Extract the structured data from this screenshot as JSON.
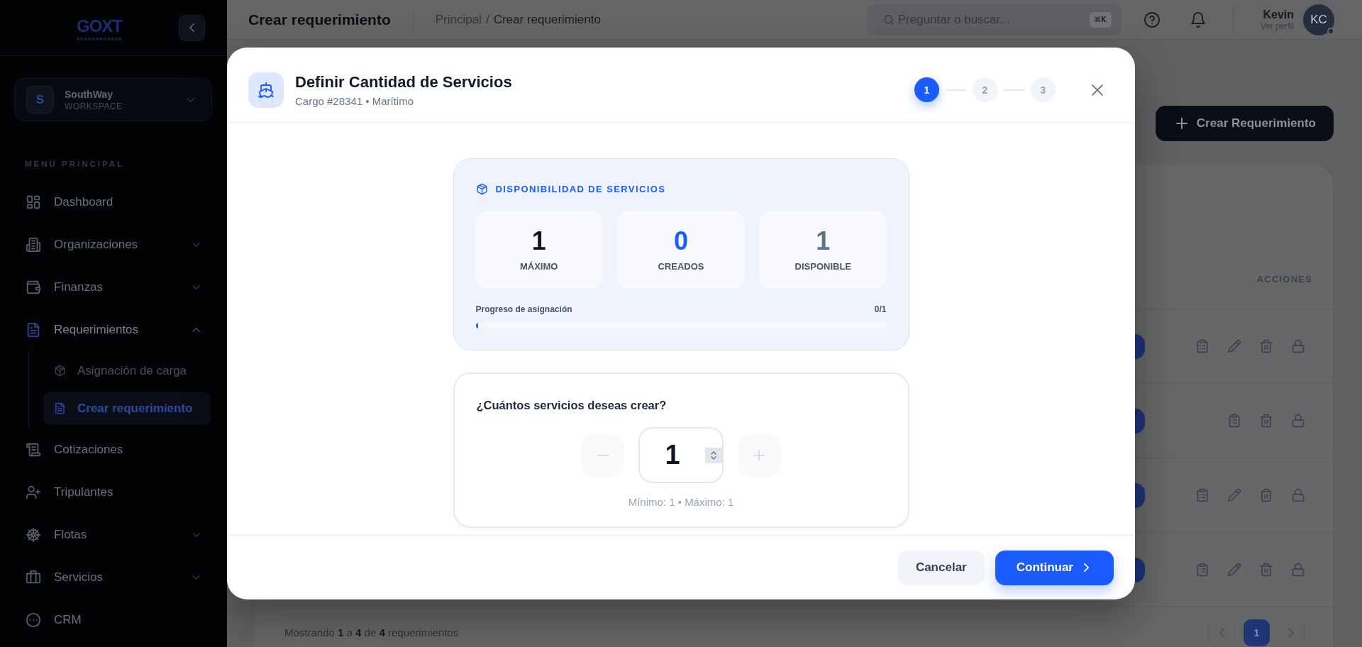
{
  "sidebar": {
    "logo": "GOXT",
    "workspace": {
      "initial": "S",
      "name": "SouthWay",
      "label": "WORKSPACE"
    },
    "section_title": "MENÚ PRINCIPAL",
    "items": [
      {
        "label": "Dashboard",
        "kind": "link",
        "selected": false
      },
      {
        "label": "Organizaciones",
        "kind": "group",
        "expanded": false,
        "selected": false
      },
      {
        "label": "Finanzas",
        "kind": "group",
        "expanded": false,
        "selected": false
      },
      {
        "label": "Requerimientos",
        "kind": "group",
        "expanded": true,
        "selected": true,
        "children": [
          {
            "label": "Asignación de carga",
            "selected": false
          },
          {
            "label": "Crear requerimiento",
            "selected": true
          }
        ]
      },
      {
        "label": "Cotizaciones",
        "kind": "link",
        "selected": false
      },
      {
        "label": "Tripulantes",
        "kind": "link",
        "selected": false
      },
      {
        "label": "Flotas",
        "kind": "group",
        "expanded": false,
        "selected": false
      },
      {
        "label": "Servicios",
        "kind": "group",
        "expanded": false,
        "selected": false
      },
      {
        "label": "CRM",
        "kind": "link",
        "selected": false
      }
    ]
  },
  "header": {
    "title": "Crear requerimiento",
    "breadcrumb": [
      "Principal",
      "Crear requerimiento"
    ],
    "breadcrumb_separator": "/",
    "search": {
      "placeholder": "Preguntar o buscar...",
      "shortcut": "⌘K"
    },
    "user": {
      "name": "Kevin",
      "link": "Ver perfil",
      "initials": "KC"
    }
  },
  "page": {
    "create_button": "Crear Requerimiento",
    "table": {
      "columns": [
        {
          "label": "ACCIONES"
        }
      ],
      "rows": [
        {
          "editable": true
        },
        {
          "editable": false
        },
        {
          "editable": true
        },
        {
          "editable": true
        }
      ],
      "footer": "Mostrando **1** a **4** de **4** requerimientos",
      "pages": [
        {
          "label": "1",
          "selected": true
        }
      ]
    }
  },
  "modal": {
    "title": "Definir Cantidad de Servicios",
    "subtitle": "Cargo #28341 • Marítimo",
    "steps": [
      {
        "label": "1",
        "selected": true
      },
      {
        "label": "2",
        "selected": false
      },
      {
        "label": "3",
        "selected": false
      }
    ],
    "availability": {
      "title": "DISPONIBILIDAD DE SERVICIOS",
      "stats": [
        {
          "value": "1",
          "label": "MÁXIMO",
          "color": "#111827"
        },
        {
          "value": "0",
          "label": "CREADOS",
          "color": "#1a5cff"
        },
        {
          "value": "1",
          "label": "DISPONIBLE",
          "color": "#5d7487"
        }
      ],
      "progress": {
        "label": "Progreso de asignación",
        "reading": "0/1",
        "level": 0
      }
    },
    "quantity": {
      "question": "¿Cuántos servicios deseas crear?",
      "value": "1",
      "decrement": {
        "disabled": true
      },
      "increment": {
        "disabled": true
      },
      "hint": "Mínimo: 1 • Máximo: 1"
    },
    "buttons": [
      {
        "label": "Cancelar",
        "kind": "secondary"
      },
      {
        "label": "Continuar",
        "kind": "primary"
      }
    ]
  }
}
